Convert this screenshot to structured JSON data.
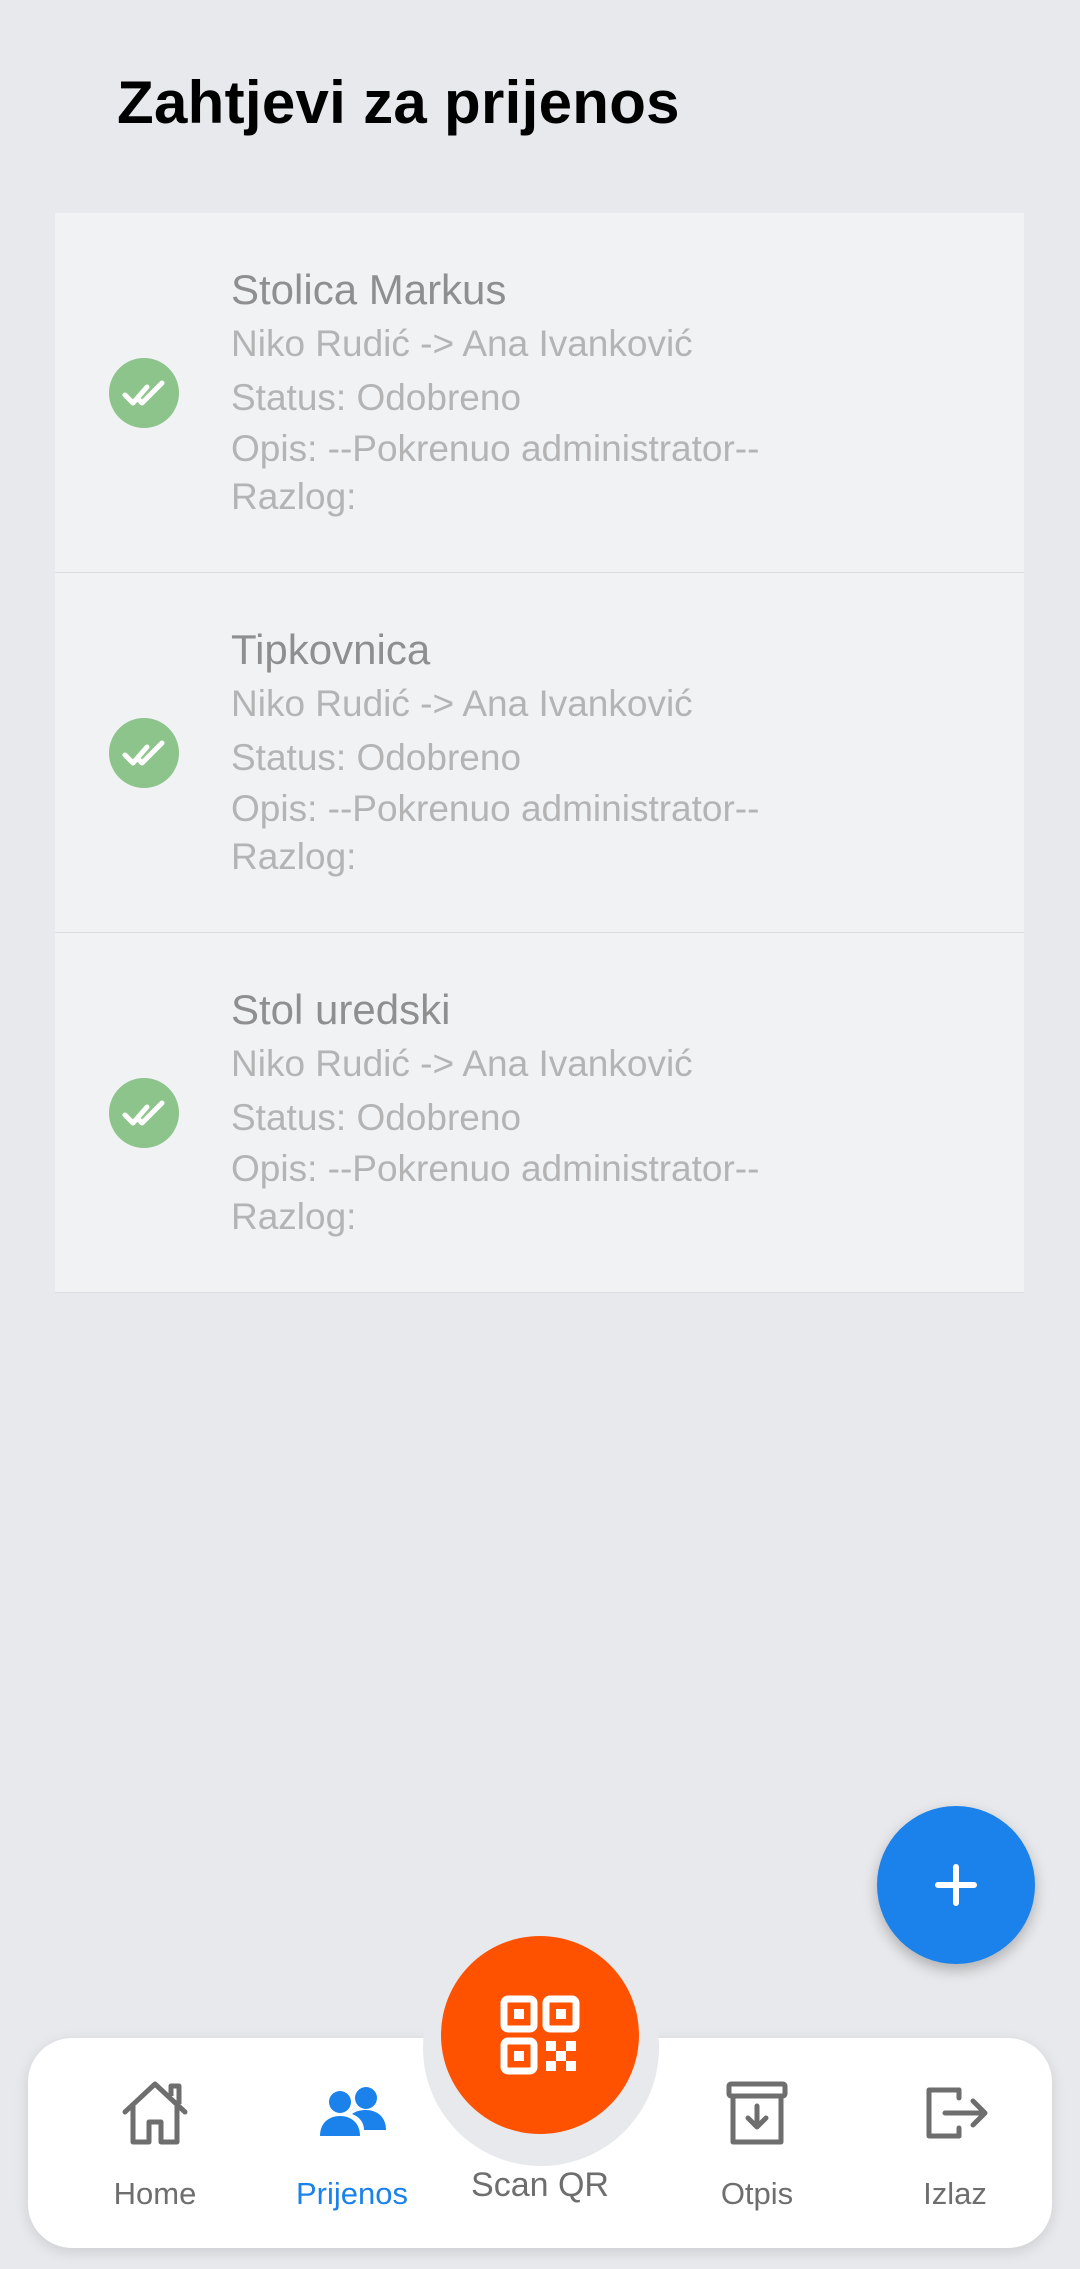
{
  "page": {
    "title": "Zahtjevi za prijenos"
  },
  "transfers": [
    {
      "title": "Stolica Markus",
      "route": "Niko Rudić -> Ana Ivanković",
      "status": "Status: Odobreno",
      "description": "Opis: --Pokrenuo administrator--",
      "reason": "Razlog:"
    },
    {
      "title": "Tipkovnica",
      "route": "Niko Rudić -> Ana Ivanković",
      "status": "Status: Odobreno",
      "description": "Opis: --Pokrenuo administrator--",
      "reason": "Razlog:"
    },
    {
      "title": "Stol uredski",
      "route": "Niko Rudić -> Ana Ivanković",
      "status": "Status: Odobreno",
      "description": "Opis: --Pokrenuo administrator--",
      "reason": "Razlog:"
    }
  ],
  "fab": {
    "icon": "plus-icon"
  },
  "nav": {
    "home": {
      "label": "Home",
      "icon": "home-icon"
    },
    "transfer": {
      "label": "Prijenos",
      "icon": "users-icon"
    },
    "scan": {
      "label": "Scan QR",
      "icon": "qr-code-icon"
    },
    "writeoff": {
      "label": "Otpis",
      "icon": "archive-download-icon"
    },
    "logout": {
      "label": "Izlaz",
      "icon": "logout-icon"
    }
  },
  "colors": {
    "accent": "#1a82ea",
    "scan": "#ff5200",
    "approved": "#8cc48b"
  }
}
